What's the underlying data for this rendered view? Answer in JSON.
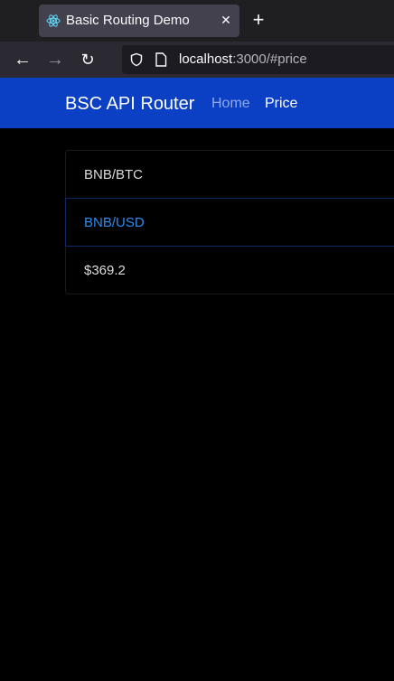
{
  "browser": {
    "tab": {
      "title": "Basic Routing Demo",
      "close_glyph": "✕",
      "favicon": "react-icon"
    },
    "new_tab_glyph": "+",
    "toolbar": {
      "back_glyph": "←",
      "forward_glyph": "→",
      "reload_glyph": "↻",
      "url_host": "localhost",
      "url_rest": ":3000/#price"
    }
  },
  "navbar": {
    "brand": "BSC API Router",
    "links": [
      {
        "label": "Home",
        "active": false
      },
      {
        "label": "Price",
        "active": true
      }
    ],
    "background": "#0b3fc4"
  },
  "list": {
    "items": [
      {
        "label": "BNB/BTC",
        "selected": false
      },
      {
        "label": "BNB/USD",
        "selected": true
      },
      {
        "label": "$369.2",
        "selected": false
      }
    ]
  },
  "colors": {
    "accent": "#2d8cf0",
    "page_background": "#000000"
  }
}
